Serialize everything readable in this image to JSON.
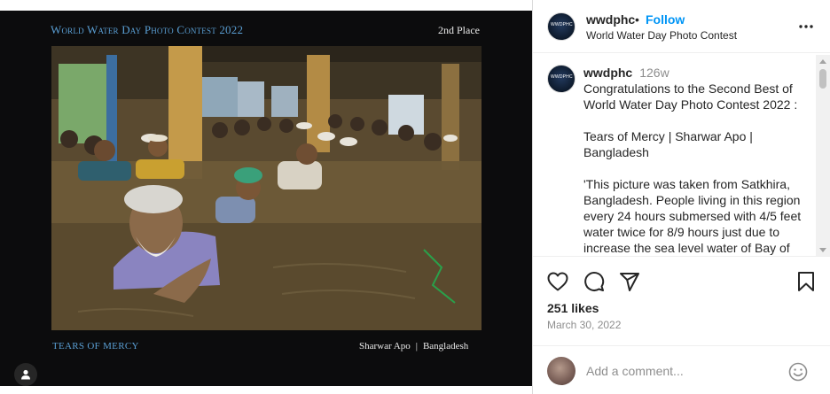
{
  "post": {
    "contest_title": "World Water Day Photo Contest 2022",
    "place": "2nd Place",
    "caption_title": "TEARS OF MERCY",
    "photographer": "Sharwar Apo",
    "separator": "|",
    "country": "Bangladesh",
    "photo_icon": "photo-of-people-praying-in-floodwater"
  },
  "header": {
    "username": "wwdphc",
    "dot": "•",
    "follow_label": "Follow",
    "subtitle": "World Water Day Photo Contest",
    "avatar_text": "WWDPHC"
  },
  "comment": {
    "username": "wwdphc",
    "time": "126w",
    "paragraphs": [
      "Congratulations to the Second Best of World Water Day Photo Contest 2022 :",
      "Tears of Mercy | Sharwar Apo | Bangladesh",
      "'This picture was taken from Satkhira, Bangladesh. People living in this region every 24 hours submersed with 4/5 feet water twice for 8/9 hours just due to increase the sea level water of Bay of"
    ]
  },
  "actions": {
    "icons": [
      "heart-icon",
      "comment-icon",
      "share-icon",
      "bookmark-icon"
    ]
  },
  "likes": "251 likes",
  "date": "March 30, 2022",
  "add_comment": {
    "placeholder": "Add a comment...",
    "emoji_icon": "smiley-icon"
  },
  "colors": {
    "accent": "#0095f6",
    "contest_blue": "#5a9fd4",
    "media_bg": "#0c0c0d",
    "muted": "#8e8e8e"
  }
}
